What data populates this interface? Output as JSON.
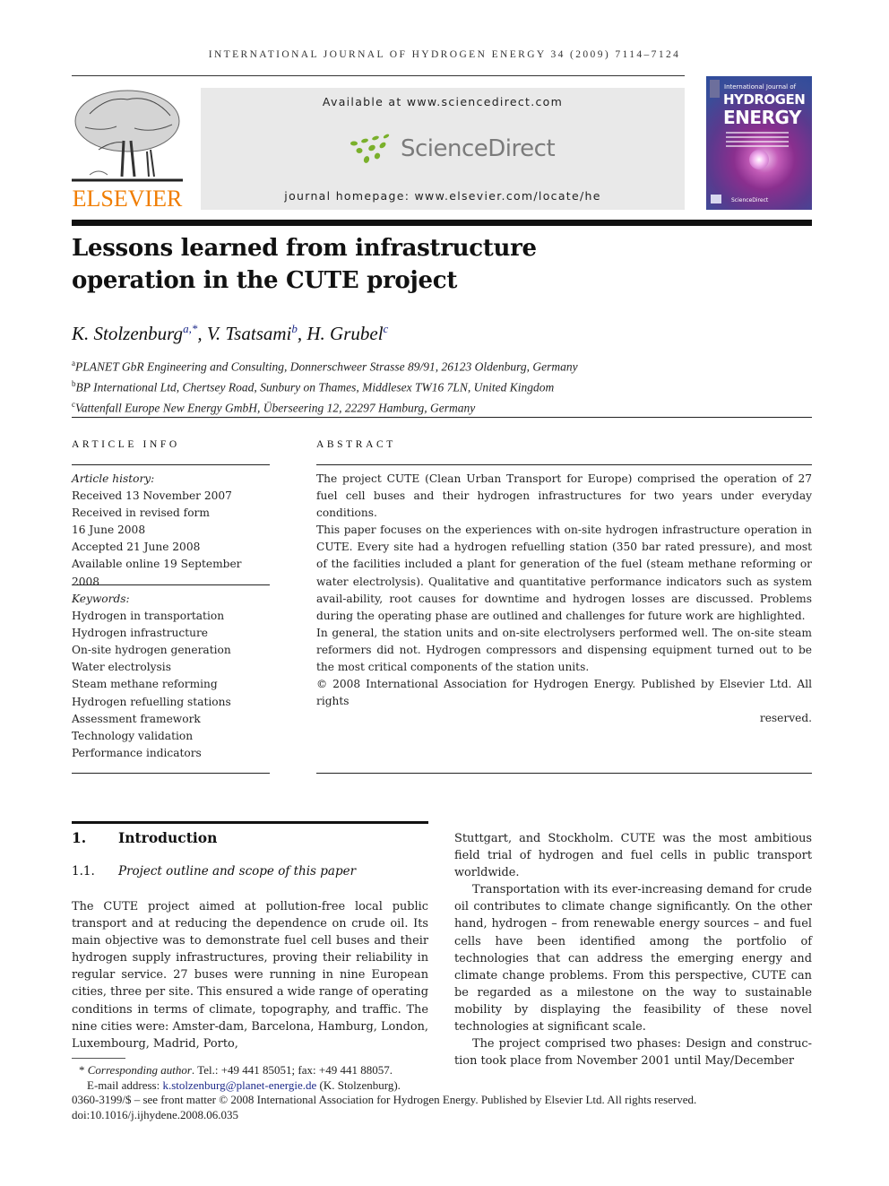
{
  "running_head": "International Journal of Hydrogen Energy 34 (2009) 7114–7124",
  "masthead": {
    "publisher": "ELSEVIER",
    "available_at": "Available at www.sciencedirect.com",
    "sciencedirect_logo_text": "ScienceDirect",
    "journal_homepage": "journal homepage: www.elsevier.com/locate/he",
    "cover": {
      "line1": "International Journal of",
      "line2": "HYDROGEN",
      "line3": "ENERGY",
      "footer": "ScienceDirect"
    },
    "colors": {
      "elsevier_orange": "#f07d00",
      "sciencedirect_green": "#7ab02b",
      "sciencedirect_gray": "#7b7b7b",
      "link_blue": "#1d2a8a"
    }
  },
  "article": {
    "title_line1": "Lessons learned from infrastructure",
    "title_line2": "operation in the CUTE project",
    "authors": [
      {
        "name": "K. Stolzenburg",
        "marks": "a,*"
      },
      {
        "name": "V. Tsatsami",
        "marks": "b"
      },
      {
        "name": "H. Grubel",
        "marks": "c"
      }
    ],
    "affiliations": [
      {
        "mark": "a",
        "text": "PLANET GbR Engineering and Consulting, Donnerschweer Strasse 89/91, 26123 Oldenburg, Germany"
      },
      {
        "mark": "b",
        "text": "BP International Ltd, Chertsey Road, Sunbury on Thames, Middlesex TW16 7LN, United Kingdom"
      },
      {
        "mark": "c",
        "text": "Vattenfall Europe New Energy GmbH, Überseering 12, 22297 Hamburg, Germany"
      }
    ]
  },
  "article_info": {
    "heading": "ARTICLE INFO",
    "history_label": "Article history:",
    "history": [
      "Received 13 November 2007",
      "Received in revised form",
      "16 June 2008",
      "Accepted 21 June 2008",
      "Available online 19 September 2008"
    ],
    "keywords_label": "Keywords:",
    "keywords": [
      "Hydrogen in transportation",
      "Hydrogen infrastructure",
      "On-site hydrogen generation",
      "Water electrolysis",
      "Steam methane reforming",
      "Hydrogen refuelling stations",
      "Assessment framework",
      "Technology validation",
      "Performance indicators"
    ]
  },
  "abstract": {
    "heading": "ABSTRACT",
    "paragraphs": [
      "The project CUTE (Clean Urban Transport for Europe) comprised the operation of 27 fuel cell buses and their hydrogen infrastructures for two years under everyday conditions.",
      "This paper focuses on the experiences with on-site hydrogen infrastructure operation in CUTE. Every site had a hydrogen refuelling station (350 bar rated pressure), and most of the facilities included a plant for generation of the fuel (steam methane reforming or water electrolysis). Qualitative and quantitative performance indicators such as system avail-ability, root causes for downtime and hydrogen losses are discussed. Problems during the operating phase are outlined and challenges for future work are highlighted.",
      "In general, the station units and on-site electrolysers performed well. The on-site steam reformers did not. Hydrogen compressors and dispensing equipment turned out to be the most critical components of the station units."
    ],
    "copyright": "© 2008 International Association for Hydrogen Energy. Published by Elsevier Ltd. All rights",
    "copyright_end": "reserved."
  },
  "body": {
    "section1": {
      "number": "1.",
      "title": "Introduction"
    },
    "section1_1": {
      "number": "1.1.",
      "title": "Project outline and scope of this paper"
    },
    "left_paragraph": "The CUTE project aimed at pollution-free local public transport and at reducing the dependence on crude oil. Its main objective was to demonstrate fuel cell buses and their hydrogen supply infrastructures, proving their reliability in regular service. 27 buses were running in nine European cities, three per site. This ensured a wide range of operating conditions in terms of climate, topography, and traffic. The nine cities were: Amster-dam, Barcelona, Hamburg, London, Luxembourg, Madrid, Porto,",
    "right_paragraphs": [
      "Stuttgart, and Stockholm. CUTE was the most ambitious field trial of hydrogen and fuel cells in public transport worldwide.",
      "Transportation with its ever-increasing demand for crude oil contributes to climate change significantly. On the other hand, hydrogen – from renewable energy sources – and fuel cells have been identified among the portfolio of technologies that can address the emerging energy and climate change problems. From this perspective, CUTE can be regarded as a milestone on the way to sustainable mobility by displaying the feasibility of these novel technologies at significant scale.",
      "The project comprised two phases: Design and construc-tion took place from November 2001 until May/December"
    ]
  },
  "footnotes": {
    "corresponding_mark": "*",
    "corresponding_label": "Corresponding author",
    "corresponding_contact": ". Tel.: +49 441 85051; fax: +49 441 88057.",
    "email_label": "E-mail address: ",
    "email": "k.stolzenburg@planet-energie.de",
    "email_suffix": " (K. Stolzenburg).",
    "front_matter": "0360-3199/$ – see front matter © 2008 International Association for Hydrogen Energy. Published by Elsevier Ltd. All rights reserved.",
    "doi": "doi:10.1016/j.ijhydene.2008.06.035"
  }
}
